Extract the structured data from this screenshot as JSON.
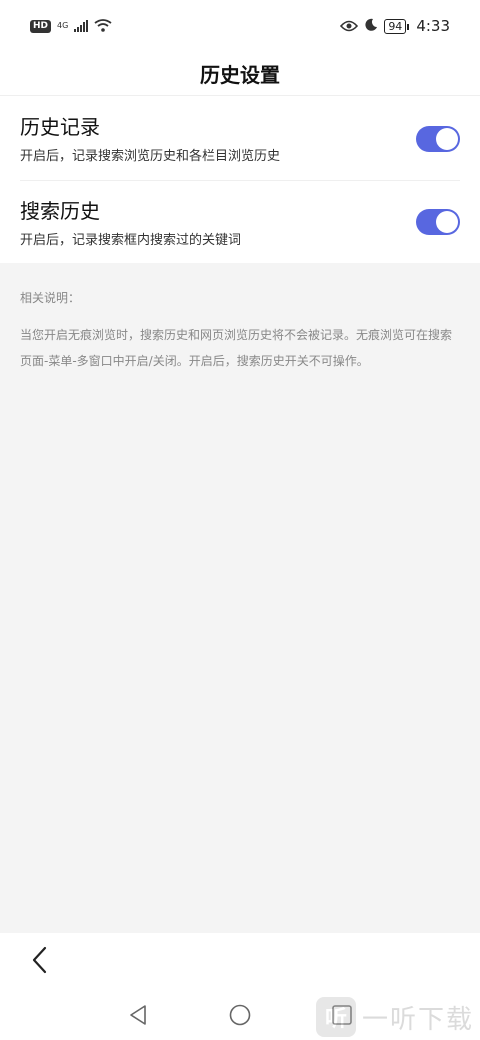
{
  "status_bar": {
    "hd": "HD",
    "network": "4G",
    "battery": "94",
    "time": "4:33",
    "icons": [
      "signal-icon",
      "wifi-icon",
      "eye-icon",
      "moon-icon",
      "battery-icon"
    ]
  },
  "header": {
    "title": "历史设置"
  },
  "settings": [
    {
      "label": "历史记录",
      "desc": "开启后，记录搜索浏览历史和各栏目浏览历史",
      "enabled": true
    },
    {
      "label": "搜索历史",
      "desc": "开启后，记录搜索框内搜索过的关键词",
      "enabled": true
    }
  ],
  "notes": {
    "title": "相关说明：",
    "body": "当您开启无痕浏览时，搜索历史和网页浏览历史将不会被记录。无痕浏览可在搜索页面-菜单-多窗口中开启/关闭。开启后，搜索历史开关不可操作。"
  },
  "toolbar": {
    "back_icon": "chevron-left-icon"
  },
  "nav": {
    "icons": [
      "nav-back-icon",
      "nav-home-icon",
      "nav-recents-icon"
    ]
  },
  "watermark": {
    "text": "一听下载",
    "logo": "听"
  },
  "colors": {
    "accent": "#5867e0",
    "background": "#f4f4f4"
  }
}
